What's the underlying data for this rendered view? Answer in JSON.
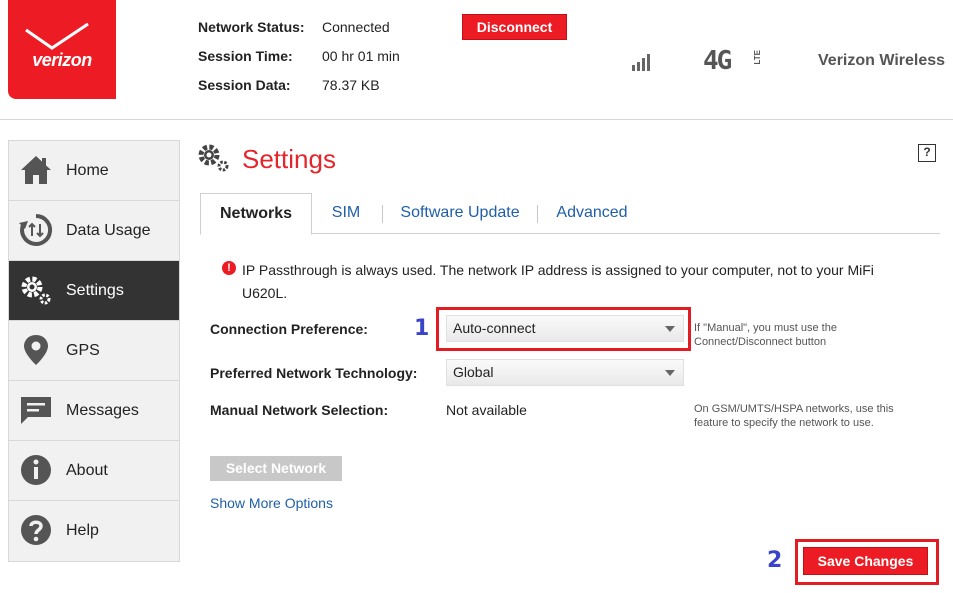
{
  "header": {
    "brand": "verizon",
    "status": [
      {
        "label": "Network Status:",
        "value": "Connected"
      },
      {
        "label": "Session Time:",
        "value": "00 hr 01 min"
      },
      {
        "label": "Session Data:",
        "value": "78.37 KB"
      }
    ],
    "disconnect_label": "Disconnect",
    "network_type": "4G",
    "network_sub": "LTE",
    "carrier": "Verizon Wireless",
    "brand_color": "#ed1c24"
  },
  "sidebar": {
    "items": [
      {
        "label": "Home",
        "icon": "home-icon"
      },
      {
        "label": "Data Usage",
        "icon": "data-usage-icon"
      },
      {
        "label": "Settings",
        "icon": "gear-icon",
        "active": true
      },
      {
        "label": "GPS",
        "icon": "location-pin-icon"
      },
      {
        "label": "Messages",
        "icon": "message-icon"
      },
      {
        "label": "About",
        "icon": "info-icon"
      },
      {
        "label": "Help",
        "icon": "question-icon"
      }
    ]
  },
  "main": {
    "title": "Settings",
    "help_icon": "?",
    "tabs": [
      {
        "label": "Networks",
        "active": true
      },
      {
        "label": "SIM"
      },
      {
        "label": "Software Update"
      },
      {
        "label": "Advanced"
      }
    ],
    "info": "IP Passthrough is always used. The network IP address is assigned to your computer, not to your MiFi U620L.",
    "form": {
      "connection_preference": {
        "label": "Connection Preference:",
        "value": "Auto-connect",
        "hint": "If \"Manual\", you must use the Connect/Disconnect button"
      },
      "preferred_network": {
        "label": "Preferred Network Technology:",
        "value": "Global"
      },
      "manual_selection": {
        "label": "Manual Network Selection:",
        "value": "Not available",
        "hint": "On GSM/UMTS/HSPA networks, use this feature to specify the network to use."
      }
    },
    "select_network_label": "Select Network",
    "more_options_label": "Show More Options",
    "save_label": "Save Changes"
  },
  "annotations": {
    "first": "1",
    "second": "2"
  }
}
